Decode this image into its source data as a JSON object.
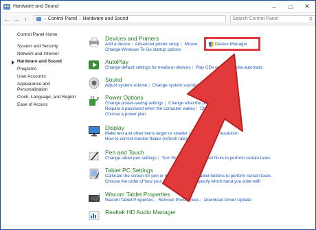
{
  "window": {
    "title": "Hardware and Sound"
  },
  "address": {
    "crumbs": [
      "Control Panel",
      "Hardware and Sound"
    ],
    "search_placeholder": "Search Control Panel"
  },
  "sidebar": {
    "items": [
      {
        "label": "Control Panel Home"
      },
      {
        "label": "System and Security"
      },
      {
        "label": "Network and Internet"
      },
      {
        "label": "Hardware and Sound",
        "active": true
      },
      {
        "label": "Programs"
      },
      {
        "label": "User Accounts"
      },
      {
        "label": "Appearance and Personalization"
      },
      {
        "label": "Clock, Language, and Region"
      },
      {
        "label": "Ease of Access"
      }
    ]
  },
  "categories": [
    {
      "title": "Devices and Printers",
      "lines": [
        [
          "Add a device",
          "Advanced printer setup",
          "Mouse"
        ],
        [
          "Change Windows To Go startup options"
        ]
      ]
    },
    {
      "title": "AutoPlay",
      "lines": [
        [
          "Change default settings for media or devices",
          "Play CDs or other media automatic"
        ]
      ]
    },
    {
      "title": "Sound",
      "lines": [
        [
          "Adjust system volume",
          "Change system sounds",
          "Manage audio"
        ]
      ]
    },
    {
      "title": "Power Options",
      "lines": [
        [
          "Change power-saving settings",
          "Change what the power buttons do"
        ],
        [
          "Require a password when the computer wakes",
          "Change when the"
        ],
        [
          "Choose a power plan"
        ]
      ]
    },
    {
      "title": "Display",
      "lines": [
        [
          "Make text and other items larger or smaller",
          "Adjust screen resolution"
        ],
        [
          "How to correct monitor flicker (refresh rate)"
        ]
      ]
    },
    {
      "title": "Pen and Touch",
      "lines": [
        [
          "Change tablet pen settings",
          "Turn flicks on and off",
          "Set flicks to perform certain tasks"
        ]
      ]
    },
    {
      "title": "Tablet PC Settings",
      "lines": [
        [
          "Calibrate the screen for pen or touch input",
          "Set tablet buttons to perform certain tasks"
        ],
        [
          "Choose the order of how your screen rotates",
          "Specify which hand you write with"
        ]
      ]
    },
    {
      "title": "Wacom Tablet Properties",
      "lines": [
        [
          "Wacom Tablet Properties",
          "Remove Preferences",
          "Download Driver Update"
        ]
      ]
    },
    {
      "title": "Realtek HD Audio Manager",
      "lines": []
    }
  ],
  "device_manager": {
    "label": "Device Manager"
  },
  "watermark": {
    "brand": "wiki",
    "suffix": "How"
  },
  "colors": {
    "category_title": "#1e7a1e",
    "link": "#1a55b8",
    "highlight": "#e23a3a",
    "arrow": "#e23a3a"
  }
}
